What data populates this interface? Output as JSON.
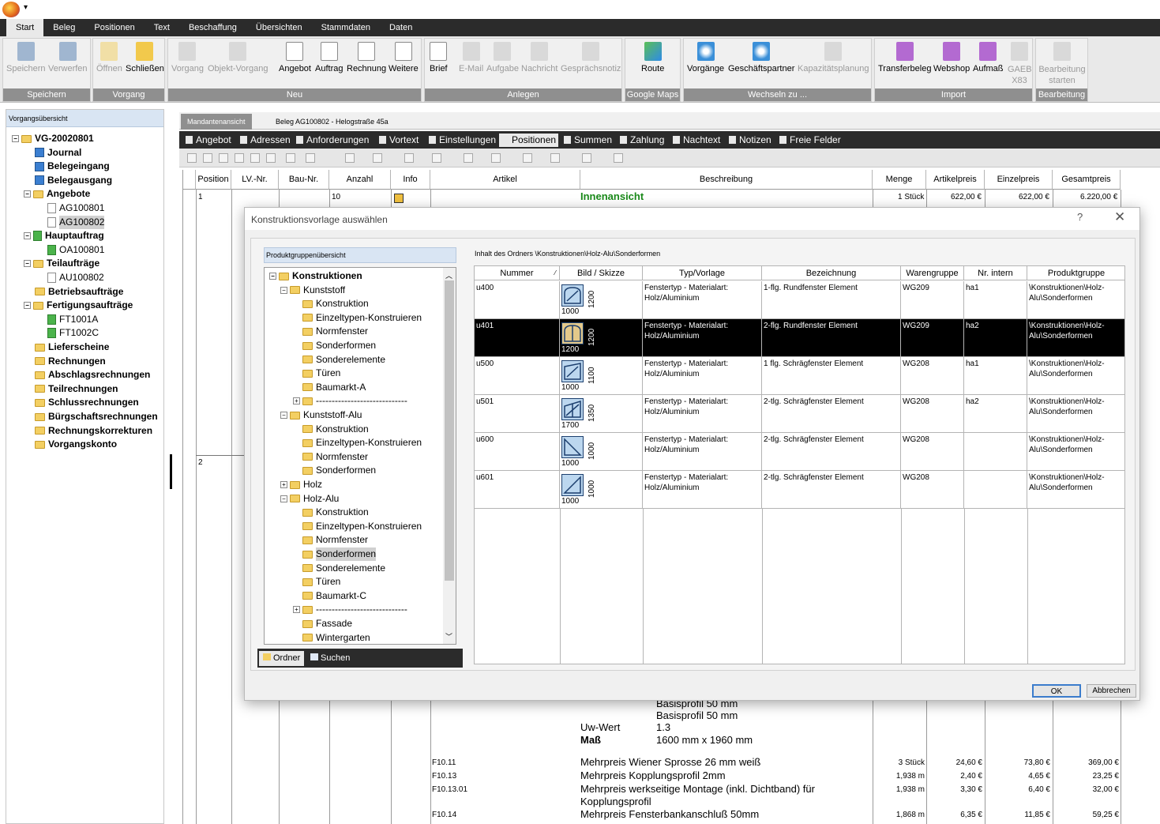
{
  "app": {
    "quick_access": "▾"
  },
  "ribbon_tabs": [
    "Start",
    "Beleg",
    "Positionen",
    "Text",
    "Beschaffung",
    "Übersichten",
    "Stammdaten",
    "Daten"
  ],
  "ribbon_groups": [
    {
      "label": "Speichern",
      "buttons": [
        "Speichern",
        "Verwerfen"
      ]
    },
    {
      "label": "Vorgang",
      "buttons": [
        "Öffnen",
        "Schließen"
      ]
    },
    {
      "label": "Neu",
      "buttons": [
        "Vorgang",
        "Objekt-Vorgang",
        "Angebot",
        "Auftrag",
        "Rechnung",
        "Weitere"
      ]
    },
    {
      "label": "Anlegen",
      "buttons": [
        "Brief",
        "E-Mail",
        "Aufgabe",
        "Nachricht",
        "Gesprächsnotiz"
      ]
    },
    {
      "label": "Google Maps",
      "buttons": [
        "Route"
      ]
    },
    {
      "label": "Wechseln zu ...",
      "buttons": [
        "Vorgänge",
        "Geschäftspartner",
        "Kapazitätsplanung"
      ]
    },
    {
      "label": "Import",
      "buttons": [
        "Transferbeleg",
        "Webshop",
        "Aufmaß",
        "GAEB X83"
      ]
    },
    {
      "label": "Bearbeitung",
      "buttons": [
        "Bearbeitung starten"
      ]
    }
  ],
  "left_panel": {
    "header": "Vorgangsübersicht",
    "items": [
      "VG-20020801",
      "Journal",
      "Belegeingang",
      "Belegausgang",
      "Angebote",
      "AG100801",
      "AG100802",
      "Hauptauftrag",
      "OA100801",
      "Teilaufträge",
      "AU100802",
      "Betriebsaufträge",
      "Fertigungsaufträge",
      "FT1001A",
      "FT1002C",
      "Lieferscheine",
      "Rechnungen",
      "Abschlagsrechnungen",
      "Teilrechnungen",
      "Schlussrechnungen",
      "Bürgschaftsrechnungen",
      "Rechnungskorrekturen",
      "Vorgangskonto"
    ]
  },
  "main": {
    "tabs": [
      "Mandantenansicht",
      "Beleg AG100802 - Helogstraße 45a"
    ],
    "subtabs": [
      "Angebot",
      "Adressen",
      "Anforderungen",
      "Vortext",
      "Einstellungen",
      "Positionen",
      "Summen",
      "Zahlung",
      "Nachtext",
      "Notizen",
      "Freie Felder"
    ],
    "columns": [
      "Position",
      "LV.-Nr.",
      "Bau-Nr.",
      "Anzahl",
      "Info",
      "Artikel",
      "Beschreibung",
      "Menge",
      "Artikelpreis",
      "Einzelpreis",
      "Gesamtpreis"
    ],
    "row1": {
      "position": "1",
      "anzahl": "10",
      "beschreibung": "Innenansicht",
      "menge": "1 Stück",
      "artikelpreis": "622,00 €",
      "einzelpreis": "622,00 €",
      "gesamtpreis": "6.220,00 €"
    },
    "row2": {
      "position": "2"
    },
    "desc_lines": [
      {
        "label": "",
        "value": "Basisprofil 50 mm"
      },
      {
        "label": "",
        "value": "Basisprofil 50 mm"
      },
      {
        "label": "Uw-Wert",
        "value": "1.3"
      },
      {
        "label": "Maß",
        "value": "1600 mm x 1960 mm"
      }
    ],
    "extra_rows": [
      {
        "artikel": "F10.11",
        "beschreibung": "Mehrpreis Wiener Sprosse 26 mm weiß",
        "beschreibung2": "",
        "menge": "3 Stück",
        "artikelpreis": "24,60 €",
        "einzelpreis": "73,80 €",
        "gesamtpreis": "369,00 €"
      },
      {
        "artikel": "F10.13",
        "beschreibung": "Mehrpreis Kopplungsprofil 2mm",
        "beschreibung2": "",
        "menge": "1,938 m",
        "artikelpreis": "2,40 €",
        "einzelpreis": "4,65 €",
        "gesamtpreis": "23,25 €"
      },
      {
        "artikel": "F10.13.01",
        "beschreibung": "Mehrpreis werkseitige Montage (inkl. Dichtband) für",
        "beschreibung2": "Kopplungsprofil",
        "menge": "1,938 m",
        "artikelpreis": "3,30 €",
        "einzelpreis": "6,40 €",
        "gesamtpreis": "32,00 €"
      },
      {
        "artikel": "F10.14",
        "beschreibung": "Mehrpreis Fensterbankanschluß 50mm",
        "beschreibung2": "",
        "menge": "1,868 m",
        "artikelpreis": "6,35 €",
        "einzelpreis": "11,85 €",
        "gesamtpreis": "59,25 €"
      }
    ]
  },
  "dialog": {
    "title": "Konstruktionsvorlage auswählen",
    "help": "?",
    "close": "✕",
    "tree_header": "Produktgruppenübersicht",
    "tree": [
      {
        "label": "Konstruktionen",
        "level": 0,
        "bold": true,
        "exp": "−"
      },
      {
        "label": "Kunststoff",
        "level": 1,
        "exp": "−"
      },
      {
        "label": "Konstruktion",
        "level": 2
      },
      {
        "label": "Einzeltypen-Konstruieren",
        "level": 2
      },
      {
        "label": "Normfenster",
        "level": 2
      },
      {
        "label": "Sonderformen",
        "level": 2
      },
      {
        "label": "Sonderelemente",
        "level": 2
      },
      {
        "label": "Türen",
        "level": 2
      },
      {
        "label": "Baumarkt-A",
        "level": 2
      },
      {
        "label": "-----------------------------",
        "level": 2,
        "exp": "+"
      },
      {
        "label": "Kunststoff-Alu",
        "level": 1,
        "exp": "−"
      },
      {
        "label": "Konstruktion",
        "level": 2
      },
      {
        "label": "Einzeltypen-Konstruieren",
        "level": 2
      },
      {
        "label": "Normfenster",
        "level": 2
      },
      {
        "label": "Sonderformen",
        "level": 2
      },
      {
        "label": "Holz",
        "level": 1,
        "exp": "+"
      },
      {
        "label": "Holz-Alu",
        "level": 1,
        "exp": "−"
      },
      {
        "label": "Konstruktion",
        "level": 2
      },
      {
        "label": "Einzeltypen-Konstruieren",
        "level": 2
      },
      {
        "label": "Normfenster",
        "level": 2
      },
      {
        "label": "Sonderformen",
        "level": 2,
        "selected": true
      },
      {
        "label": "Sonderelemente",
        "level": 2
      },
      {
        "label": "Türen",
        "level": 2
      },
      {
        "label": "Baumarkt-C",
        "level": 2
      },
      {
        "label": "-----------------------------",
        "level": 2,
        "exp": "+"
      },
      {
        "label": "Fassade",
        "level": 2
      },
      {
        "label": "Wintergarten",
        "level": 2
      }
    ],
    "bottom_tabs": [
      "Ordner",
      "Suchen"
    ],
    "folder_header": "Inhalt des Ordners \\Konstruktionen\\Holz-Alu\\Sonderformen",
    "columns": [
      "Nummer",
      "Bild / Skizze",
      "Typ/Vorlage",
      "Bezeichnung",
      "Warengruppe",
      "Nr. intern",
      "Produktgruppe"
    ],
    "rows": [
      {
        "nummer": "u400",
        "breite": "1000",
        "hoehe": "1200",
        "typ": "Fenstertyp - Materialart: Holz/Aluminium",
        "bezeichnung": "1-flg. Rundfenster Element",
        "warengruppe": "WG209",
        "intern": "ha1",
        "produktgruppe": "\\Konstruktionen\\Holz-Alu\\Sonderformen"
      },
      {
        "nummer": "u401",
        "breite": "1200",
        "hoehe": "1200",
        "typ": "Fenstertyp - Materialart: Holz/Aluminium",
        "bezeichnung": "2-flg. Rundfenster Element",
        "warengruppe": "WG209",
        "intern": "ha2",
        "produktgruppe": "\\Konstruktionen\\Holz-Alu\\Sonderformen"
      },
      {
        "nummer": "u500",
        "breite": "1000",
        "hoehe": "1100",
        "typ": "Fenstertyp - Materialart: Holz/Aluminium",
        "bezeichnung": "1 flg. Schrägfenster Element",
        "warengruppe": "WG208",
        "intern": "ha1",
        "produktgruppe": "\\Konstruktionen\\Holz-Alu\\Sonderformen"
      },
      {
        "nummer": "u501",
        "breite": "1700",
        "hoehe": "1350",
        "typ": "Fenstertyp - Materialart: Holz/Aluminium",
        "bezeichnung": "2-tlg. Schrägfenster Element",
        "warengruppe": "WG208",
        "intern": "ha2",
        "produktgruppe": "\\Konstruktionen\\Holz-Alu\\Sonderformen"
      },
      {
        "nummer": "u600",
        "breite": "1000",
        "hoehe": "1000",
        "typ": "Fenstertyp - Materialart: Holz/Aluminium",
        "bezeichnung": "2-tlg. Schrägfenster Element",
        "warengruppe": "WG208",
        "intern": "",
        "produktgruppe": "\\Konstruktionen\\Holz-Alu\\Sonderformen"
      },
      {
        "nummer": "u601",
        "breite": "1000",
        "hoehe": "1000",
        "typ": "Fenstertyp - Materialart: Holz/Aluminium",
        "bezeichnung": "2-tlg. Schrägfenster Element",
        "warengruppe": "WG208",
        "intern": "",
        "produktgruppe": "\\Konstruktionen\\Holz-Alu\\Sonderformen"
      }
    ],
    "ok": "OK",
    "cancel": "Abbrechen"
  }
}
